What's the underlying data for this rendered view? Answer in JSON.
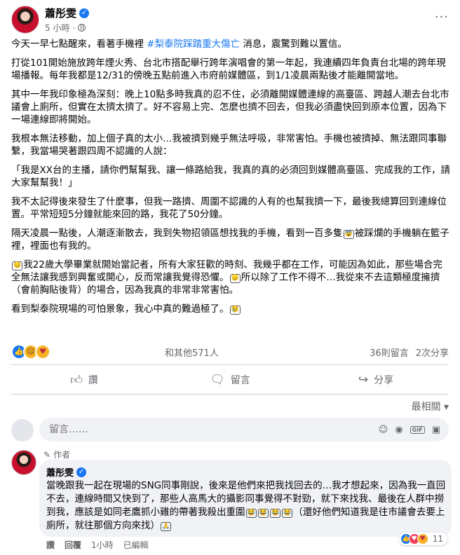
{
  "post": {
    "author": "蕭彤雯",
    "time": "5 小時",
    "paragraphs": [
      [
        {
          "t": "今天一早七點醒來，看著手機裡 "
        },
        {
          "t": "#梨泰院踩踏重大傷亡",
          "hashtag": true
        },
        {
          "t": " 消息，震驚到難以置信。"
        }
      ],
      [
        {
          "t": "打從101開始施放跨年煙火秀、台北市搭配舉行跨年演唱會的第一年起，我連續四年負責台北場的跨年現場播報。每年我都是12/31的傍晚五點前進入市府前媒體區，到1/1凌晨兩點後才能離開當地。"
        }
      ],
      [
        {
          "t": "其中一年我印象極為深刻：晚上10點多時我真的忍不住，必須離開媒體連線的高臺區、跨越人潮去台北市議會上廁所，但實在太擠太擠了。好不容易上完、怎麼也擠不回去，但我必須盡快回到原本位置，因為下一場連線即將開始。"
        }
      ],
      [
        {
          "t": "我根本無法移動，加上個子真的太小…我被擠到幾乎無法呼吸，非常害怕。手機也被擠掉、無法跟同事聯繫，我當場哭著跟四周不認識的人說："
        }
      ],
      [
        {
          "t": "「我是XX台的主播，請你們幫幫我、讓一條路給我，我真的真的必須回到媒體高臺區、完成我的工作，請大家幫幫我！」"
        }
      ],
      [
        {
          "t": "我不太記得後來發生了什麼事，但我一路擠、周圍不認識的人有的也幫我擠一下，最後我總算回到連線位置。平常短短5分鐘就能來回的路，我花了50分鐘。"
        }
      ],
      [
        {
          "t": "隔天凌晨一點後，人潮逐漸散去，我到失物招領區想找我的手機，看到一百多隻"
        },
        {
          "t": "😨",
          "emoji": true
        },
        {
          "t": "被踩爛的手機躺在籃子裡，裡面也有我的。"
        }
      ],
      [
        {
          "t": "😔",
          "emoji": true
        },
        {
          "t": "我22歲大學畢業就開始當記者，所有大家狂歡的時刻、我幾乎都在工作，可能因為如此，那些場合完全無法讓我感到興奮或開心，反而常讓我覺得恐懼。"
        },
        {
          "t": "😞",
          "emoji": true
        },
        {
          "t": "所以除了工作不得不…我從來不去這類極度擁擠（會前胸貼後背）的場合，因為我真的非常非常害怕。"
        }
      ],
      [
        {
          "t": "看到梨泰院現場的可怕景象，我心中真的難過極了。"
        },
        {
          "t": "😢",
          "emoji": true
        }
      ]
    ],
    "reactions": {
      "summary": "和其他571人",
      "comments": "36則留言",
      "shares": "2次分享"
    },
    "actions": {
      "like": "讚",
      "comment": "留言",
      "share": "分享"
    },
    "sort_label": "最相關",
    "comment_placeholder": "留言……"
  },
  "comment": {
    "author_tag": "作者",
    "author": "蕭彤雯",
    "text": [
      {
        "t": "當晚跟我一起在現場的SNG同事剛說，後來是他們來把我找回去的…我才想起來，因為我一直回不去，連線時間又快到了，那些人高馬大的攝影同事覺得不對勁，就下來找我、最後在人群中撈到我，應該是如同老鷹抓小雞的帶著我殺出重圍"
      },
      {
        "t": "😂",
        "emoji": true
      },
      {
        "t": "😂",
        "emoji": true
      },
      {
        "t": "😂",
        "emoji": true
      },
      {
        "t": "😂",
        "emoji": true
      },
      {
        "t": "（還好他們知道我是往市議會去要上廁所，就往那個方向來找）"
      },
      {
        "t": "🙏",
        "emoji": true
      }
    ],
    "like": "讚",
    "reply": "回覆",
    "time": "1小時",
    "edited": "已編輯",
    "reaction_count": "11"
  },
  "colors": {
    "accent": "#1877f2",
    "muted": "#65676b",
    "bubble": "#f0f2f5"
  }
}
